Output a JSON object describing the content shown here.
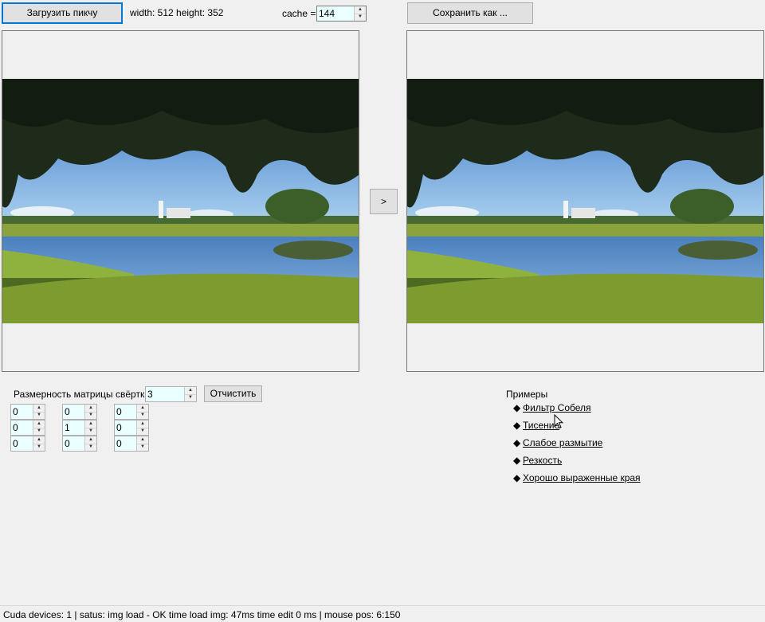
{
  "toolbar": {
    "load_button": "Загрузить пикчу",
    "image_info": "width: 512 height: 352",
    "cache_label": "cache =",
    "cache_value": "144",
    "save_button": "Сохранить как ..."
  },
  "apply_button": ">",
  "matrix": {
    "size_label": "Размерность матрицы свёртки",
    "size_value": "3",
    "clear_button": "Отчистить",
    "cells": [
      [
        "0",
        "0",
        "0"
      ],
      [
        "0",
        "1",
        "0"
      ],
      [
        "0",
        "0",
        "0"
      ]
    ]
  },
  "examples": {
    "title": "Примеры",
    "items": [
      {
        "label": "Фильтр Собеля"
      },
      {
        "label": "Тисение"
      },
      {
        "label": "Слабое размытие"
      },
      {
        "label": "Резкость"
      },
      {
        "label": "Хорошо выраженные края"
      }
    ]
  },
  "status": {
    "text": "Cuda devices: 1 |  satus: img load - OK  time load img: 47ms  time edit 0 ms  | mouse pos: 6:150"
  },
  "icons": {
    "spin_up": "arrow-up-icon",
    "spin_down": "arrow-down-icon",
    "bullet": "diamond-icon",
    "cursor": "mouse-pointer-icon"
  }
}
